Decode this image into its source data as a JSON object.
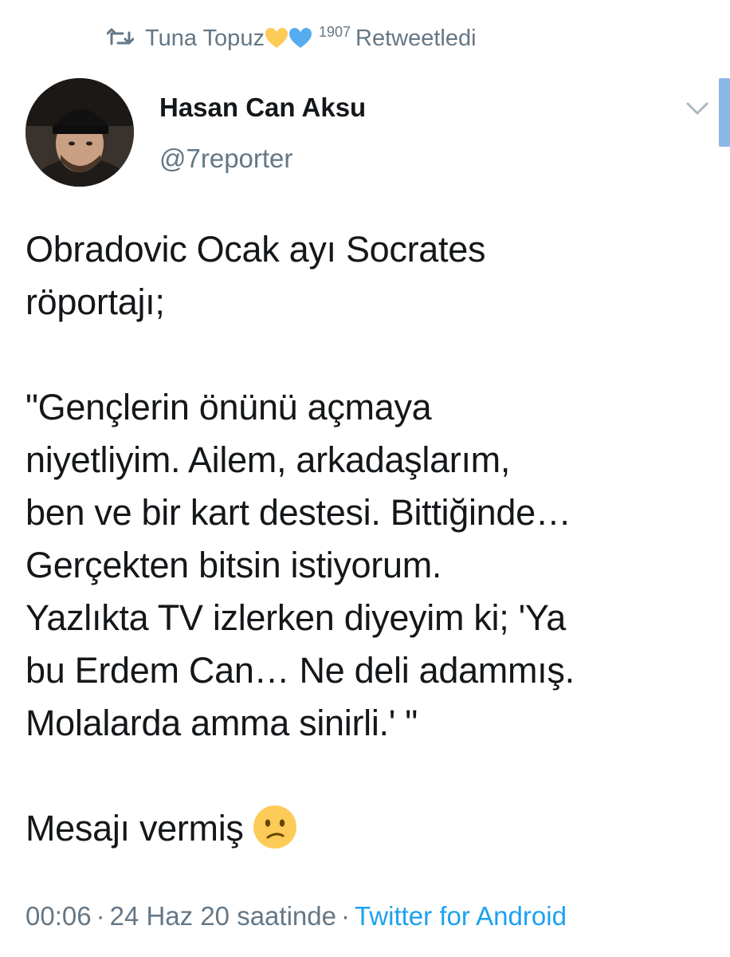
{
  "retweet": {
    "retweeter_name": "Tuna Topuz",
    "badge": "1907",
    "label": "Retweetledi",
    "icon": "retweet-icon",
    "hearts": [
      "yellow-heart-icon",
      "blue-heart-icon"
    ],
    "colors": {
      "yellow_heart": "#fdcb58",
      "blue_heart": "#55acee"
    }
  },
  "tweet": {
    "author_name": "Hasan Can Aksu",
    "author_handle": "@7reporter",
    "text": "Obradovic Ocak ayı Socrates\nröportajı;\n\n\"Gençlerin önünü açmaya\nniyetliyim. Ailem, arkadaşlarım,\nben ve bir kart destesi. Bittiğinde…\nGerçekten bitsin istiyorum.\nYazlıkta TV izlerken diyeyim ki; 'Ya\nbu Erdem Can… Ne deli adammış.\nMolalarda amma sinirli.' \"\n\n",
    "closing_line": "Mesajı vermiş",
    "closing_emoji": "confused-face-icon",
    "time": "00:06",
    "date": "24 Haz 20 saatinde",
    "separator": "·",
    "source": "Twitter for Android"
  },
  "colors": {
    "text": "#14171a",
    "secondary": "#657786",
    "link": "#1da1f2",
    "scrollbar": "#8ab8e6"
  }
}
